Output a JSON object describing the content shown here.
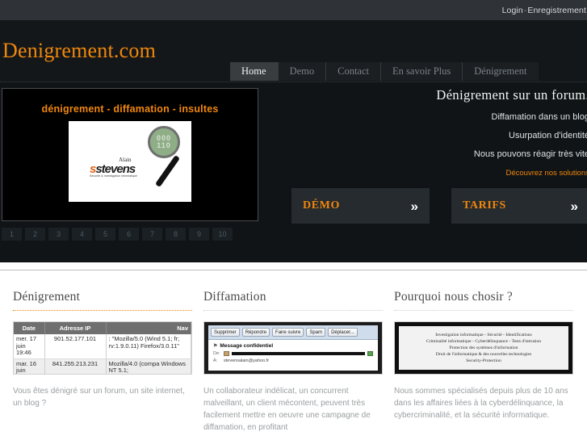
{
  "topbar": {
    "login_label": "Login",
    "separator": "-",
    "register_label": "Enregistrement"
  },
  "header": {
    "logo": "Denigrement.com",
    "nav": [
      {
        "label": "Home",
        "active": true
      },
      {
        "label": "Demo",
        "active": false
      },
      {
        "label": "Contact",
        "active": false
      },
      {
        "label": "En savoir Plus",
        "active": false
      },
      {
        "label": "Dénigrement",
        "active": false
      }
    ]
  },
  "hero": {
    "slider": {
      "caption": "dénigrement - diffamation - insultes",
      "logo_brand_top": "Alain",
      "logo_brand_main": "stevens",
      "logo_brand_sub": "Sécurité & Investigation Informatique",
      "magnifier_digits_top": "000",
      "magnifier_digits_bottom": "110"
    },
    "pager": [
      "1",
      "2",
      "3",
      "4",
      "5",
      "6",
      "7",
      "8",
      "9",
      "10"
    ],
    "headline": "Dénigrement sur un forum.",
    "lines": [
      "Diffamation dans un blog",
      "Usurpation d'identité",
      "Nous pouvons réagir très vite"
    ],
    "link": "Découvrez nos solutions",
    "cta": [
      {
        "label": "DÉMO",
        "arrow": "»"
      },
      {
        "label": "TARIFS",
        "arrow": "»"
      }
    ]
  },
  "columns": [
    {
      "title": "Dénigrement",
      "accent_rule": true,
      "thumb_type": "ip-table",
      "table": {
        "headers": [
          "Date",
          "Adresse IP",
          "Nav"
        ],
        "rows": [
          {
            "date": "mer. 17 juin 19:46",
            "ip": "901.52.177.101",
            "nav": ": \"Mozilla/5.0 (Wind 5.1; fr; rv:1.9.0.11) Firefox/3.0.11\""
          },
          {
            "date": "mar. 16 juin",
            "ip": "841.255.213.231",
            "nav": "Mozilla/4.0 (compa Windows NT 5.1;"
          }
        ]
      },
      "text": "Vous êtes dénigré sur un forum, un site internet, un blog ?"
    },
    {
      "title": "Diffamation",
      "accent_rule": false,
      "thumb_type": "mail",
      "mail": {
        "buttons": [
          "Supprimer",
          "Répondre",
          "Faire suivre",
          "Spam",
          "Déplacer..."
        ],
        "subject": "Message confidentiel",
        "from_label": "De:",
        "from_value": "",
        "to_label": "À:",
        "to_value": "stevensalain@yahoo.fr"
      },
      "text": "Un collaborateur indélicat, un concurrent malveillant, un client mécontent, peuvent très facilement mettre en oeuvre une campagne de diffamation, en profitant"
    },
    {
      "title": "Pourquoi nous chosir ?",
      "accent_rule": false,
      "thumb_type": "investigation",
      "investigation_lines": [
        "Investigation informatique - Sécurité - Identifications",
        "Criminalité informatique - Cyberdélinquance - Tests d'intrusion",
        "Protection des systèmes d'information",
        "Droit de l'informatique & des nouvelles technologies",
        "Security-Protection"
      ],
      "text": "Nous sommes spécialisés depuis plus de 10 ans dans les affaires liées à la cyberdélinquance, la cybercriminalité, et la sécurité informatique."
    }
  ],
  "colors": {
    "accent_orange": "#f0870d",
    "header_dark": "#131719",
    "topbar_gray": "#2f3236",
    "hero_dark": "#101417"
  }
}
